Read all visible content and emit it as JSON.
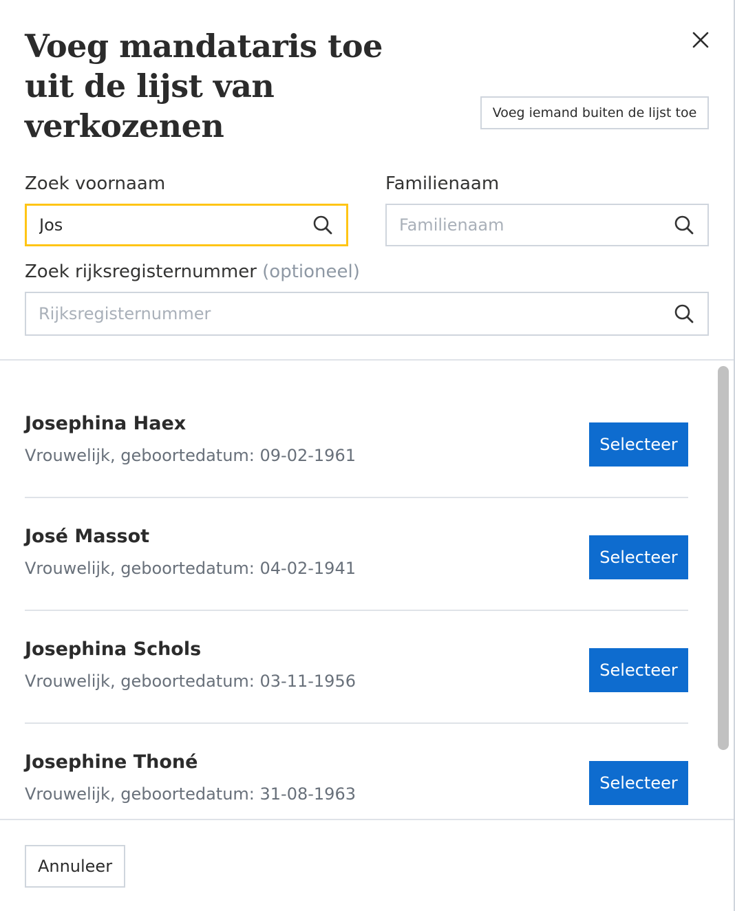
{
  "modal": {
    "title_line1": "Voeg mandataris toe",
    "title_line2": "uit de lijst van",
    "title_line3": "verkozenen",
    "close_icon": "close-icon",
    "add_outside_label": "Voeg iemand buiten de lijst toe"
  },
  "search": {
    "first_name": {
      "label": "Zoek voornaam",
      "value": "Jos",
      "placeholder": ""
    },
    "last_name": {
      "label": "Familienaam",
      "value": "",
      "placeholder": "Familienaam"
    },
    "rrn": {
      "label": "Zoek rijksregisternummer",
      "optional": "(optioneel)",
      "value": "",
      "placeholder": "Rijksregisternummer"
    },
    "icon": "search-icon",
    "focus_color": "#ffc515"
  },
  "results": [
    {
      "name": "Josephina Haex",
      "meta": "Vrouwelijk, geboortedatum: 09-02-1961",
      "button": "Selecteer"
    },
    {
      "name": "José Massot",
      "meta": "Vrouwelijk, geboortedatum: 04-02-1941",
      "button": "Selecteer"
    },
    {
      "name": "Josephina Schols",
      "meta": "Vrouwelijk, geboortedatum: 03-11-1956",
      "button": "Selecteer"
    },
    {
      "name": "Josephine Thoné",
      "meta": "Vrouwelijk, geboortedatum: 31-08-1963",
      "button": "Selecteer"
    }
  ],
  "colors": {
    "primary": "#0e6ccf",
    "border": "#cfd5dd"
  },
  "footer": {
    "cancel_label": "Annuleer"
  }
}
